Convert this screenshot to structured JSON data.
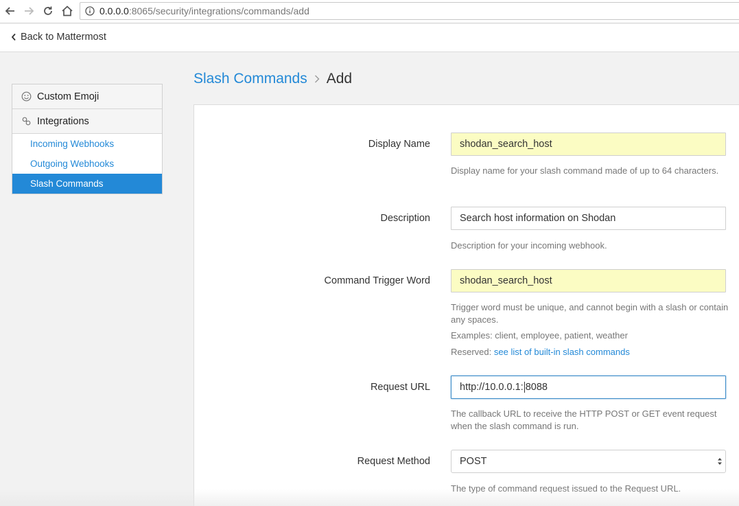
{
  "browser": {
    "url_host": "0.0.0.0",
    "url_rest": ":8065/security/integrations/commands/add"
  },
  "header": {
    "back_label": "Back to Mattermost"
  },
  "sidebar": {
    "sections": [
      {
        "label": "Custom Emoji",
        "icon": "smiley-icon"
      },
      {
        "label": "Integrations",
        "icon": "link-icon"
      }
    ],
    "items": [
      {
        "label": "Incoming Webhooks",
        "active": false
      },
      {
        "label": "Outgoing Webhooks",
        "active": false
      },
      {
        "label": "Slash Commands",
        "active": true
      }
    ]
  },
  "breadcrumb": {
    "parent": "Slash Commands",
    "current": "Add"
  },
  "form": {
    "display_name": {
      "label": "Display Name",
      "value": "shodan_search_host",
      "help": "Display name for your slash command made of up to 64 characters."
    },
    "description": {
      "label": "Description",
      "value": "Search host information on Shodan",
      "help": "Description for your incoming webhook."
    },
    "trigger_word": {
      "label": "Command Trigger Word",
      "value": "shodan_search_host",
      "help1": "Trigger word must be unique, and cannot begin with a slash or contain any spaces.",
      "help2": "Examples: client, employee, patient, weather",
      "help3_prefix": "Reserved: ",
      "help3_link": "see list of built-in slash commands"
    },
    "request_url": {
      "label": "Request URL",
      "value_before_caret": "http://10.0.0.1:",
      "value_after_caret": "8088",
      "help": "The callback URL to receive the HTTP POST or GET event request when the slash command is run."
    },
    "request_method": {
      "label": "Request Method",
      "value": "POST",
      "help": "The type of command request issued to the Request URL."
    }
  },
  "colors": {
    "accent": "#2389d7",
    "autofill": "#fbfcc3"
  }
}
